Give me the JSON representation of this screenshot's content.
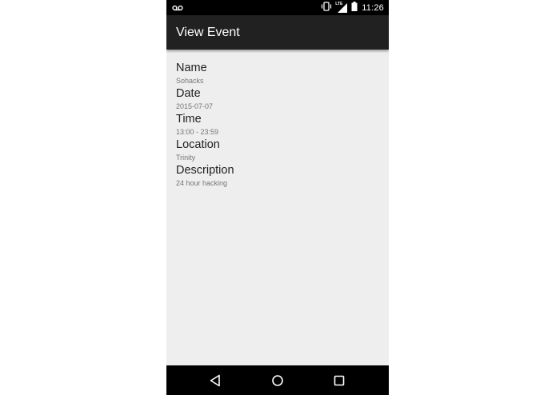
{
  "status_bar": {
    "time": "11:26",
    "icons": [
      "voicemail-icon",
      "vibrate-icon",
      "lte-signal-icon",
      "battery-icon"
    ],
    "network_label": "LTE"
  },
  "app_bar": {
    "title": "View Event",
    "color": "#212121"
  },
  "event": {
    "fields": [
      {
        "label": "Name",
        "value": "Sohacks"
      },
      {
        "label": "Date",
        "value": "2015-07-07"
      },
      {
        "label": "Time",
        "value": "13:00 - 23:59"
      },
      {
        "label": "Location",
        "value": "Trinity"
      },
      {
        "label": "Description",
        "value": "24 hour hacking"
      }
    ]
  },
  "nav_bar": {
    "buttons": [
      "back-icon",
      "home-icon",
      "recents-icon"
    ]
  },
  "colors": {
    "background": "#eeeeee",
    "label_text": "#212121",
    "value_text": "#757575"
  }
}
